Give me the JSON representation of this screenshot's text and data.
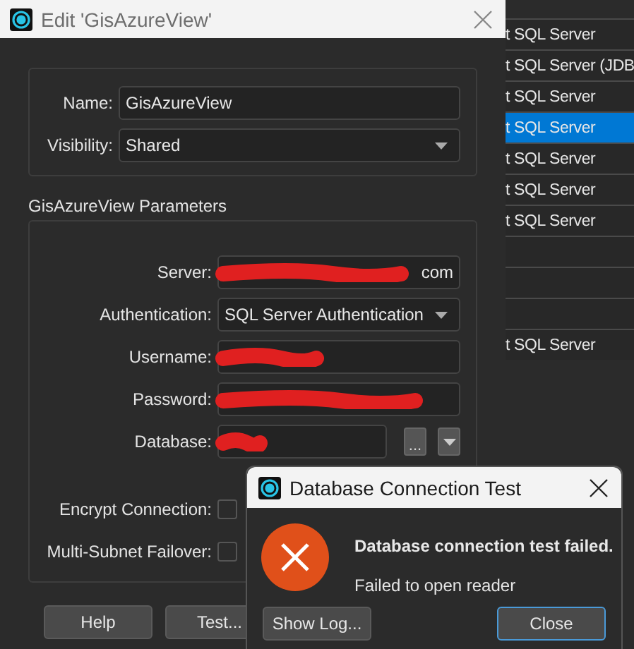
{
  "dialog": {
    "title": "Edit 'GisAzureView'",
    "name": {
      "label": "Name:",
      "value": "GisAzureView"
    },
    "visibility": {
      "label": "Visibility:",
      "value": "Shared"
    },
    "parameters_title": "GisAzureView Parameters",
    "fields": [
      {
        "kind": "text",
        "label": "Server:",
        "value": "com",
        "redacted": true
      },
      {
        "kind": "dropdown",
        "label": "Authentication:",
        "value": "SQL Server Authentication"
      },
      {
        "kind": "text",
        "label": "Username:",
        "redacted": true
      },
      {
        "kind": "text",
        "label": "Password:",
        "redacted": true
      },
      {
        "kind": "database",
        "label": "Database:",
        "redacted": true,
        "browse": "..."
      },
      {
        "kind": "checkbox",
        "label": "Encrypt Connection:",
        "checked": false
      },
      {
        "kind": "checkbox",
        "label": "Multi-Subnet Failover:",
        "checked": false
      }
    ],
    "buttons": [
      {
        "label": "Help"
      },
      {
        "label": "Test..."
      }
    ]
  },
  "background_list": {
    "rows": [
      {
        "text": "t SQL Server",
        "selected": false
      },
      {
        "text": "t SQL Server (JDB",
        "selected": false
      },
      {
        "text": "t SQL Server",
        "selected": false
      },
      {
        "text": "t SQL Server",
        "selected": true
      },
      {
        "text": "t SQL Server",
        "selected": false
      },
      {
        "text": "t SQL Server",
        "selected": false
      },
      {
        "text": "t SQL Server",
        "selected": false
      },
      {
        "selected": false
      },
      {
        "selected": false
      },
      {
        "selected": false
      },
      {
        "text": "t SQL Server",
        "selected": false
      }
    ]
  },
  "popup": {
    "title": "Database Connection Test",
    "heading": "Database connection test failed.",
    "message": "Failed to open reader",
    "buttons": [
      {
        "label": "Show Log...",
        "default": false
      },
      {
        "label": "Close",
        "default": true
      }
    ]
  }
}
